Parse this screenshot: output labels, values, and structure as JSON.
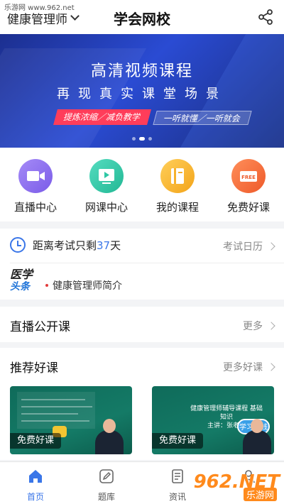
{
  "watermark_top": "乐游网 www.962.net",
  "header": {
    "subject": "健康管理师",
    "title": "学会网校"
  },
  "banner": {
    "headline": "高清视频课程",
    "subheadline": "再现真实课堂场景",
    "tag_left": "提炼浓缩／减负教学",
    "tag_right": "一听就懂／一听就会",
    "dots": 3,
    "active_dot": 1
  },
  "quick_entries": [
    {
      "label": "直播中心",
      "icon": "video-camera-icon",
      "color": "#8b6cf0"
    },
    {
      "label": "网课中心",
      "icon": "play-screen-icon",
      "color": "#2ec7a5"
    },
    {
      "label": "我的课程",
      "icon": "book-icon",
      "color": "#f6b12c"
    },
    {
      "label": "免费好课",
      "icon": "free-tag-icon",
      "color": "#f26b3a"
    }
  ],
  "exam": {
    "countdown_prefix": "距离考试只剩",
    "days": "37",
    "countdown_suffix": "天",
    "calendar_link": "考试日历",
    "news_logo_top": "医学",
    "news_logo_bottom": "头条",
    "news_text": "健康管理师简介"
  },
  "live_section": {
    "title": "直播公开课",
    "more": "更多"
  },
  "recommend_section": {
    "title": "推荐好课",
    "more": "更多好课",
    "courses": [
      {
        "badge": "免费好课"
      },
      {
        "badge": "免费好课",
        "slide_title": "健康管理师辅导课程 基础知识",
        "speaker": "主讲：张老师",
        "sticker": "学习曲线"
      }
    ]
  },
  "tabbar": {
    "tabs": [
      {
        "label": "首页",
        "icon": "home-icon",
        "active": true
      },
      {
        "label": "题库",
        "icon": "edit-icon",
        "active": false
      },
      {
        "label": "资讯",
        "icon": "document-icon",
        "active": false
      },
      {
        "label": "",
        "icon": "user-icon",
        "active": false
      }
    ]
  },
  "watermark_bottom": {
    "big": "962.NET",
    "small": "乐游网"
  },
  "colors": {
    "accent": "#3a76e8",
    "banner": "#2a4bd3",
    "badge_red": "#ff3d5a"
  }
}
